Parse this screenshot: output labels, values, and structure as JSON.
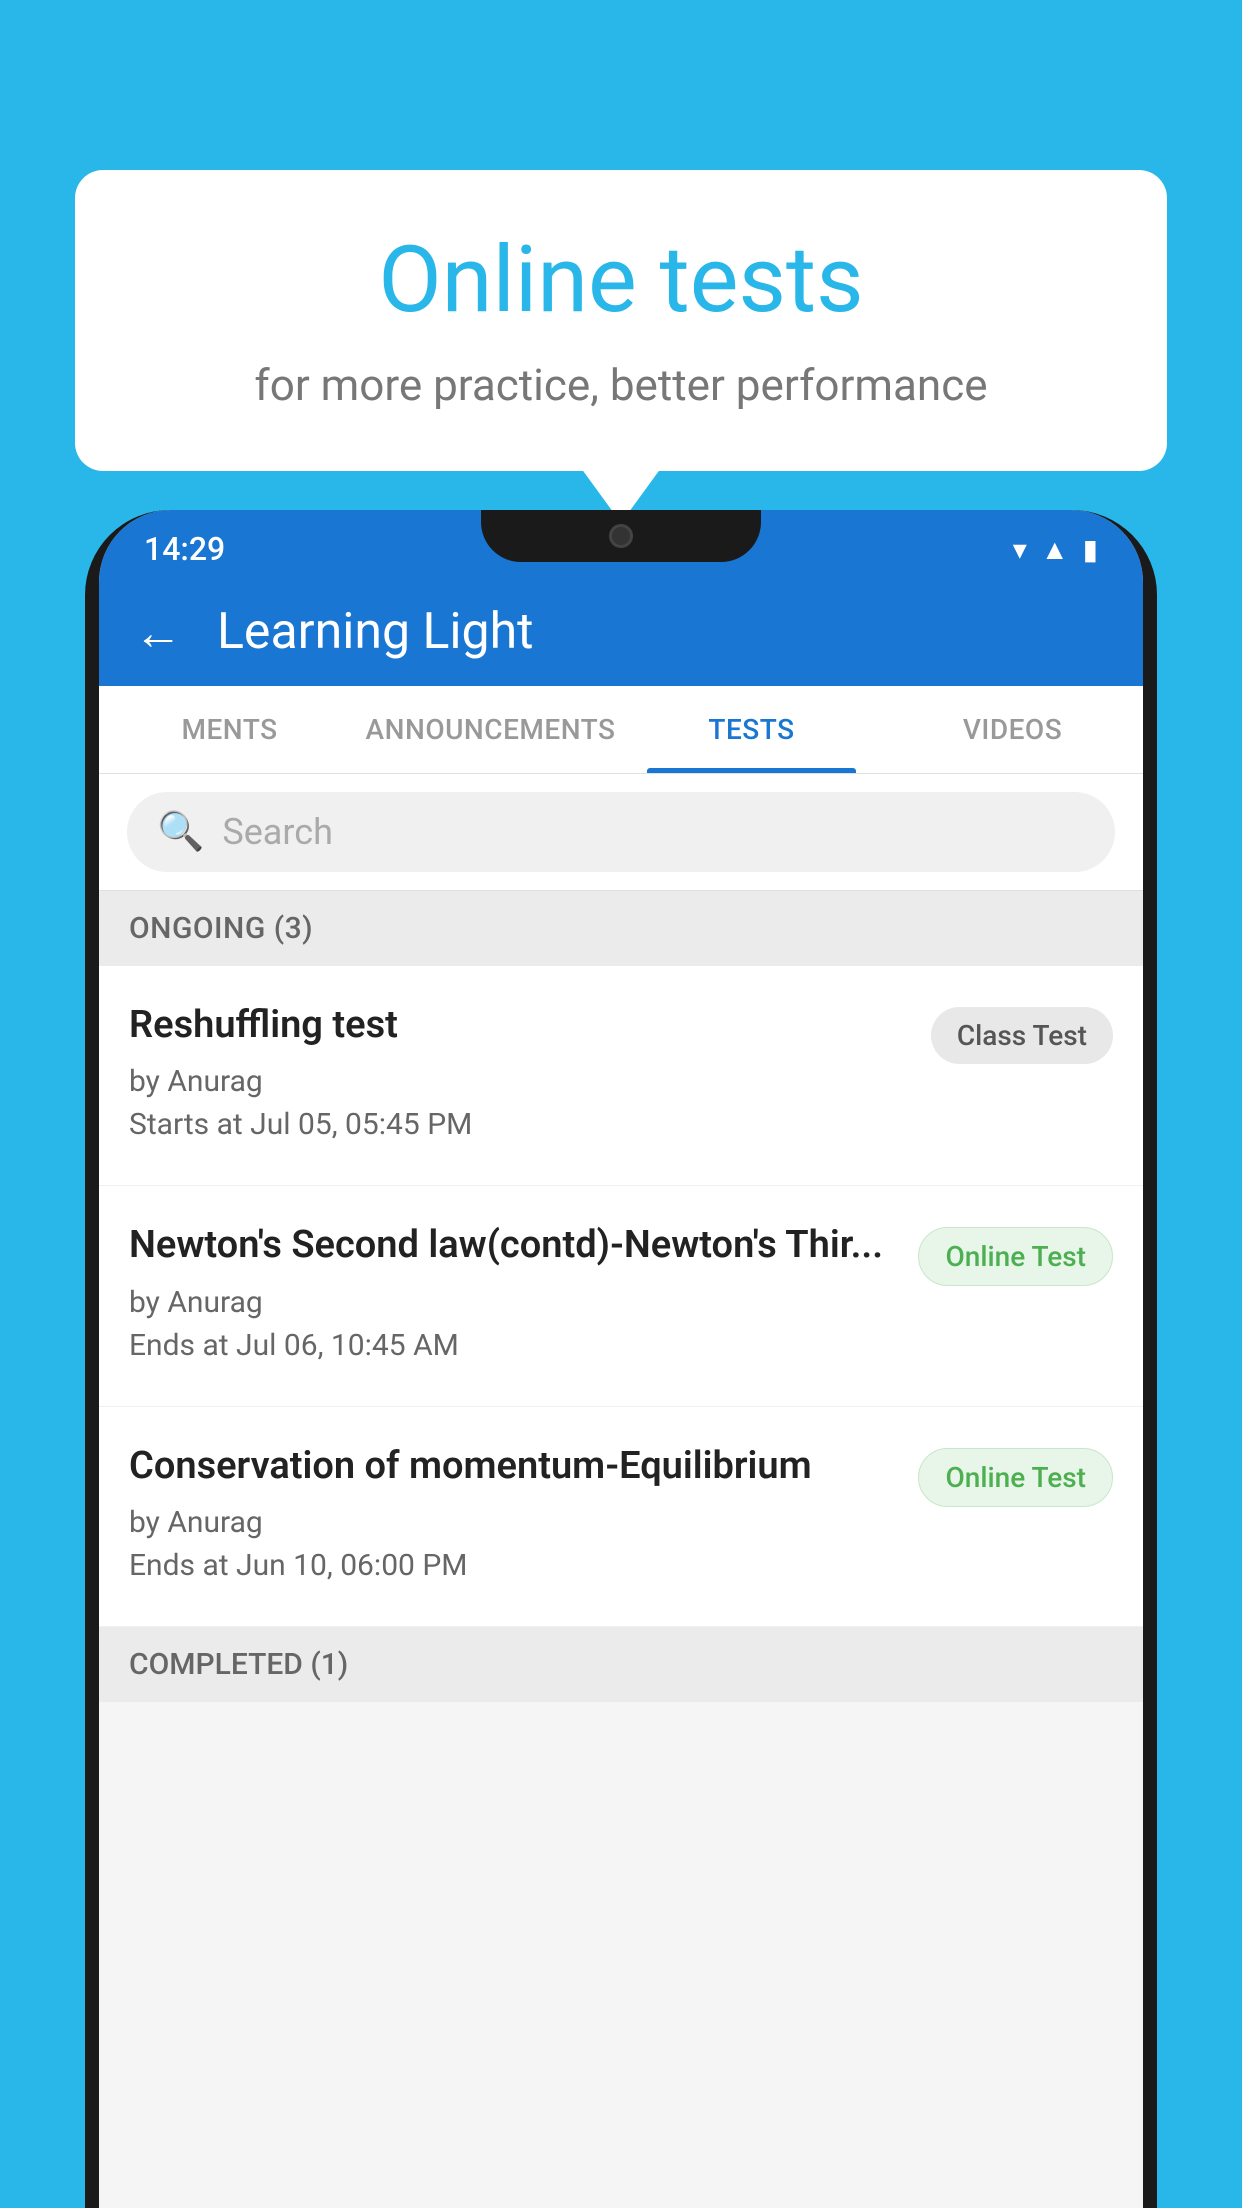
{
  "background": {
    "color": "#29b6e8"
  },
  "speech_bubble": {
    "title": "Online tests",
    "subtitle": "for more practice, better performance"
  },
  "phone": {
    "status_bar": {
      "time": "14:29",
      "icons": [
        "wifi",
        "signal",
        "battery"
      ]
    },
    "header": {
      "title": "Learning Light",
      "back_label": "←"
    },
    "tabs": [
      {
        "label": "MENTS",
        "active": false
      },
      {
        "label": "ANNOUNCEMENTS",
        "active": false
      },
      {
        "label": "TESTS",
        "active": true
      },
      {
        "label": "VIDEOS",
        "active": false
      }
    ],
    "search": {
      "placeholder": "Search"
    },
    "ongoing_section": {
      "title": "ONGOING (3)"
    },
    "tests": [
      {
        "name": "Reshuffling test",
        "by": "by Anurag",
        "time_label": "Starts at  Jul 05, 05:45 PM",
        "badge": "Class Test",
        "badge_type": "class"
      },
      {
        "name": "Newton's Second law(contd)-Newton's Thir...",
        "by": "by Anurag",
        "time_label": "Ends at  Jul 06, 10:45 AM",
        "badge": "Online Test",
        "badge_type": "online"
      },
      {
        "name": "Conservation of momentum-Equilibrium",
        "by": "by Anurag",
        "time_label": "Ends at  Jun 10, 06:00 PM",
        "badge": "Online Test",
        "badge_type": "online"
      }
    ],
    "completed_section": {
      "title": "COMPLETED (1)"
    }
  }
}
